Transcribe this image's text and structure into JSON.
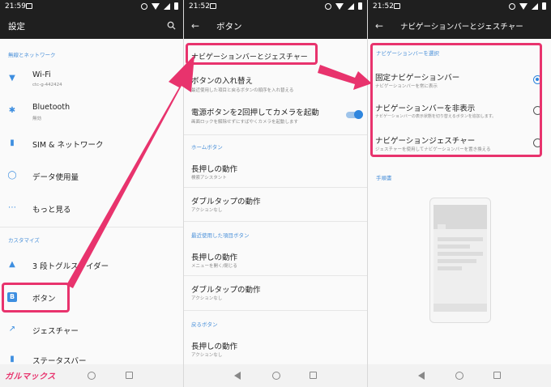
{
  "status": {
    "p1_time": "21:59",
    "p2_time": "21:52",
    "p3_time": "21:52"
  },
  "p1": {
    "title": "設定",
    "section_network": "無線とネットワーク",
    "wifi_label": "Wi-Fi",
    "wifi_sub": "ctc-g-442424",
    "bluetooth_label": "Bluetooth",
    "bluetooth_sub": "無効",
    "sim_label": "SIM & ネットワーク",
    "data_label": "データ使用量",
    "more_label": "もっと見る",
    "section_customize": "カスタマイズ",
    "slider_label": "3 段トグルスライダー",
    "buttons_label": "ボタン",
    "gestures_label": "ジェスチャー",
    "statusbar_label": "ステータスバー",
    "logo_text": "ガルマックス"
  },
  "p2": {
    "title": "ボタン",
    "navbar_label": "ナビゲーションバーとジェスチャー",
    "swap_label": "ボタンの入れ替え",
    "swap_sub": "最近使用した項目と戻るボタンの順序を入れ替える",
    "power_label": "電源ボタンを2回押してカメラを起動",
    "power_sub": "画面ロックを解除せずにすばやくカメラを起動します",
    "home_section": "ホームボタン",
    "home_long_label": "長押しの動作",
    "home_long_sub": "検索アシスタント",
    "home_double_label": "ダブルタップの動作",
    "home_double_sub": "アクションなし",
    "recent_section": "最近使用した項目ボタン",
    "recent_long_label": "長押しの動作",
    "recent_long_sub": "メニューを開く/閉じる",
    "recent_double_label": "ダブルタップの動作",
    "recent_double_sub": "アクションなし",
    "back_section": "戻るボタン",
    "back_long_label": "長押しの動作",
    "back_long_sub": "アクションなし"
  },
  "p3": {
    "title": "ナビゲーションバーとジェスチャー",
    "section": "ナビゲーションバーを選択",
    "opt1_label": "固定ナビゲーションバー",
    "opt1_sub": "ナビゲーションバーを常に表示",
    "opt2_label": "ナビゲーションバーを非表示",
    "opt2_sub": "ナビゲーションバーの表示状態を切り替えるボタンを追加します。",
    "opt3_label": "ナビゲーションジェスチャー",
    "opt3_sub": "ジェスチャーを使用してナビゲーションバーを置き換える",
    "guide_section": "手順書",
    "selected_option": 1
  },
  "colors": {
    "accent": "#2f86de",
    "highlight": "#e8336d",
    "appbar": "#1f1f1f"
  }
}
